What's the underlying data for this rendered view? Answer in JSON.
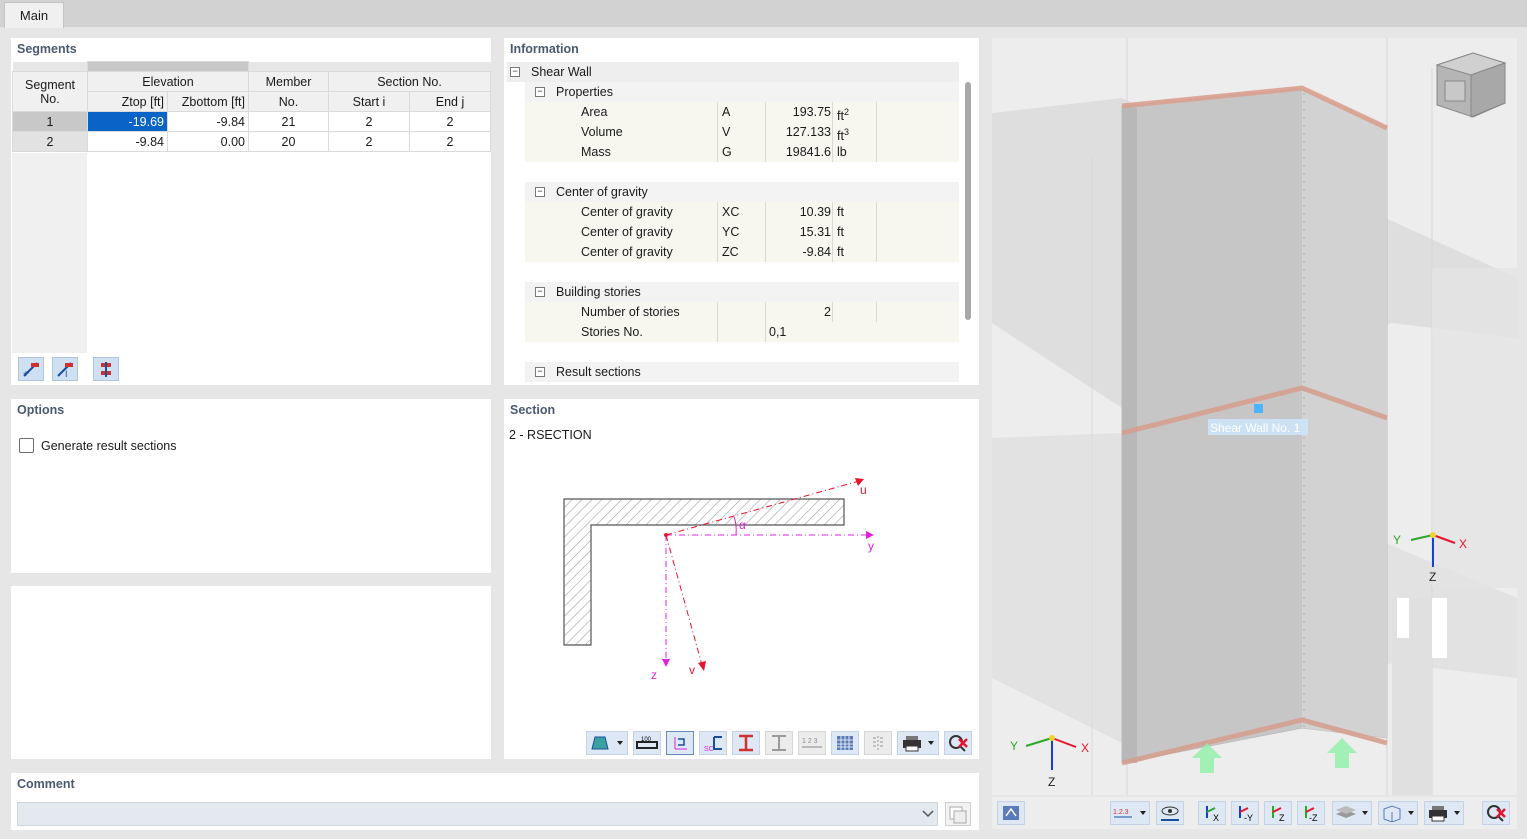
{
  "tabs": [
    {
      "label": "Main"
    }
  ],
  "segments": {
    "title": "Segments",
    "headers": {
      "segment_no": "Segment\nNo.",
      "segment_line1": "Segment",
      "segment_line2": "No.",
      "elevation": "Elevation",
      "ztop": "Ztop [ft]",
      "zbottom": "Zbottom [ft]",
      "member": "Member",
      "member_no": "No.",
      "section_no": "Section No.",
      "start_i": "Start i",
      "end_j": "End j"
    },
    "rows": [
      {
        "no": "1",
        "ztop": "-19.69",
        "zbottom": "-9.84",
        "member": "21",
        "start": "2",
        "end": "2"
      },
      {
        "no": "2",
        "ztop": "-9.84",
        "zbottom": "0.00",
        "member": "20",
        "start": "2",
        "end": "2"
      }
    ]
  },
  "information": {
    "title": "Information",
    "root": "Shear Wall",
    "groups": {
      "properties": "Properties",
      "cog": "Center of gravity",
      "stories": "Building stories",
      "result": "Result sections"
    },
    "properties": [
      {
        "label": "Area",
        "sym": "A",
        "val": "193.75",
        "unit": "ft",
        "sup": "2"
      },
      {
        "label": "Volume",
        "sym": "V",
        "val": "127.133",
        "unit": "ft",
        "sup": "3"
      },
      {
        "label": "Mass",
        "sym": "G",
        "val": "19841.6",
        "unit": "lb",
        "sup": ""
      }
    ],
    "cog": [
      {
        "label": "Center of gravity",
        "sym": "XC",
        "val": "10.39",
        "unit": "ft"
      },
      {
        "label": "Center of gravity",
        "sym": "YC",
        "val": "15.31",
        "unit": "ft"
      },
      {
        "label": "Center of gravity",
        "sym": "ZC",
        "val": "-9.84",
        "unit": "ft"
      }
    ],
    "stories": [
      {
        "label": "Number of stories",
        "val": "2"
      },
      {
        "label": "Stories No.",
        "val": "0,1"
      }
    ]
  },
  "options": {
    "title": "Options",
    "generate_label": "Generate result sections",
    "generate_checked": false
  },
  "section": {
    "title": "Section",
    "name": "2 - RSECTION",
    "labels": {
      "u": "u",
      "y": "y",
      "z": "z",
      "v": "v",
      "alpha": "α"
    }
  },
  "comment": {
    "title": "Comment",
    "value": ""
  },
  "view3d": {
    "wall_label": "Shear Wall No. 1",
    "axes": {
      "x": "X",
      "y": "Y",
      "z": "Z"
    },
    "toolbar": {
      "numbering": "1.2.3",
      "dir_x": "X",
      "dir_y": "-Y",
      "dir_z": "Z",
      "dir_neg_z": "-Z"
    }
  },
  "section_toolbar": {
    "scale_label": "100",
    "numbering": "1 2 3"
  },
  "colors": {
    "accent": "#0a64c8",
    "title": "#4a5a6e",
    "axis_x": "#e8142d",
    "axis_y": "#2aa82a",
    "axis_z": "#1a3ed0",
    "section_red": "#e8142d",
    "section_magenta": "#e020e0"
  }
}
